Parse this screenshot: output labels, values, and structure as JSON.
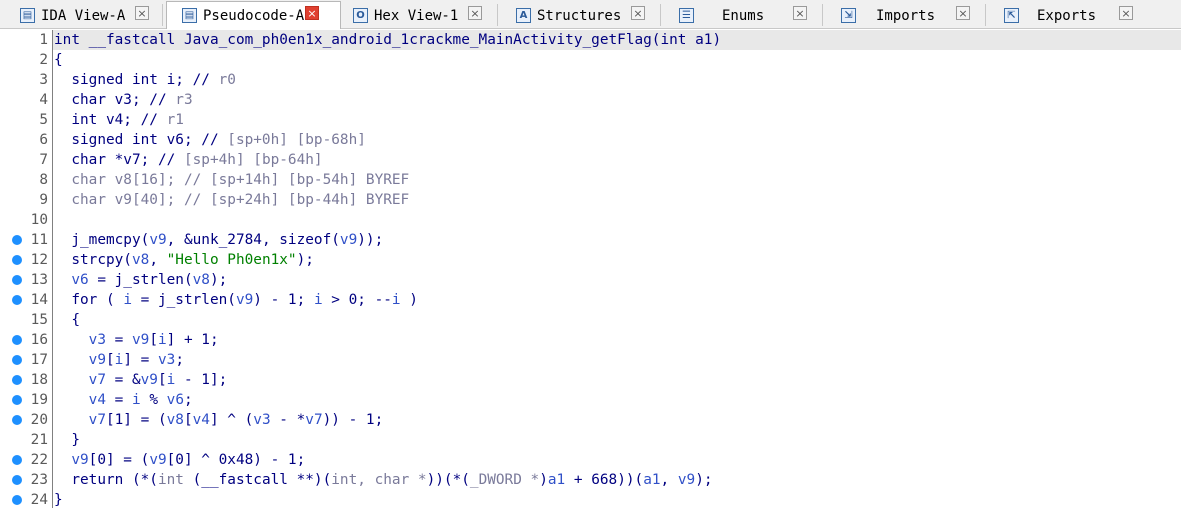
{
  "tabs": [
    {
      "label": "IDA View-A",
      "icon": "ida-view-icon",
      "glyph": "▤",
      "active": false
    },
    {
      "label": "Pseudocode-A",
      "icon": "pseudocode-icon",
      "glyph": "▤",
      "active": true
    },
    {
      "label": "Hex View-1",
      "icon": "hex-view-icon",
      "glyph": "O",
      "active": false
    },
    {
      "label": "Structures",
      "icon": "structures-icon",
      "glyph": "A",
      "active": false
    },
    {
      "label": "Enums",
      "icon": "enums-icon",
      "glyph": "☰",
      "active": false
    },
    {
      "label": "Imports",
      "icon": "imports-icon",
      "glyph": "⇲",
      "active": false
    },
    {
      "label": "Exports",
      "icon": "exports-icon",
      "glyph": "⇱",
      "active": false
    }
  ],
  "close_glyph": "×",
  "code": [
    {
      "n": "1",
      "bp": false,
      "parts": [
        [
          "k",
          "int __fastcall Java_com_ph0en1x_android_1crackme_MainActivity_getFlag(int a1)"
        ]
      ]
    },
    {
      "n": "2",
      "bp": false,
      "parts": [
        [
          "k",
          "{"
        ]
      ]
    },
    {
      "n": "3",
      "bp": false,
      "parts": [
        [
          "k",
          "  signed int i; // "
        ],
        [
          "g",
          "r0"
        ]
      ]
    },
    {
      "n": "4",
      "bp": false,
      "parts": [
        [
          "k",
          "  char v3; // "
        ],
        [
          "g",
          "r3"
        ]
      ]
    },
    {
      "n": "5",
      "bp": false,
      "parts": [
        [
          "k",
          "  int v4; // "
        ],
        [
          "g",
          "r1"
        ]
      ]
    },
    {
      "n": "6",
      "bp": false,
      "parts": [
        [
          "k",
          "  signed int v6; // "
        ],
        [
          "g",
          "[sp+0h] [bp-68h]"
        ]
      ]
    },
    {
      "n": "7",
      "bp": false,
      "parts": [
        [
          "k",
          "  char *v7; // "
        ],
        [
          "g",
          "[sp+4h] [bp-64h]"
        ]
      ]
    },
    {
      "n": "8",
      "bp": false,
      "parts": [
        [
          "g",
          "  char v8[16]; // [sp+14h] [bp-54h] BYREF"
        ]
      ]
    },
    {
      "n": "9",
      "bp": false,
      "parts": [
        [
          "g",
          "  char v9[40]; // [sp+24h] [bp-44h] BYREF"
        ]
      ]
    },
    {
      "n": "10",
      "bp": false,
      "parts": [
        [
          "k",
          ""
        ]
      ]
    },
    {
      "n": "11",
      "bp": true,
      "parts": [
        [
          "k",
          "  j_memcpy("
        ],
        [
          "v",
          "v9"
        ],
        [
          "k",
          ", &unk_2784, sizeof("
        ],
        [
          "v",
          "v9"
        ],
        [
          "k",
          "));"
        ]
      ]
    },
    {
      "n": "12",
      "bp": true,
      "parts": [
        [
          "k",
          "  strcpy("
        ],
        [
          "v",
          "v8"
        ],
        [
          "k",
          ", "
        ],
        [
          "s",
          "\"Hello Ph0en1x\""
        ],
        [
          "k",
          ");"
        ]
      ]
    },
    {
      "n": "13",
      "bp": true,
      "parts": [
        [
          "v",
          "  v6"
        ],
        [
          "k",
          " = j_strlen("
        ],
        [
          "v",
          "v8"
        ],
        [
          "k",
          ");"
        ]
      ]
    },
    {
      "n": "14",
      "bp": true,
      "parts": [
        [
          "k",
          "  for ( "
        ],
        [
          "v",
          "i"
        ],
        [
          "k",
          " = j_strlen("
        ],
        [
          "v",
          "v9"
        ],
        [
          "k",
          ") - 1; "
        ],
        [
          "v",
          "i"
        ],
        [
          "k",
          " > 0; --"
        ],
        [
          "v",
          "i"
        ],
        [
          "k",
          " )"
        ]
      ]
    },
    {
      "n": "15",
      "bp": false,
      "parts": [
        [
          "k",
          "  {"
        ]
      ]
    },
    {
      "n": "16",
      "bp": true,
      "parts": [
        [
          "v",
          "    v3"
        ],
        [
          "k",
          " = "
        ],
        [
          "v",
          "v9"
        ],
        [
          "k",
          "["
        ],
        [
          "v",
          "i"
        ],
        [
          "k",
          "] + 1;"
        ]
      ]
    },
    {
      "n": "17",
      "bp": true,
      "parts": [
        [
          "v",
          "    v9"
        ],
        [
          "k",
          "["
        ],
        [
          "v",
          "i"
        ],
        [
          "k",
          "] = "
        ],
        [
          "v",
          "v3"
        ],
        [
          "k",
          ";"
        ]
      ]
    },
    {
      "n": "18",
      "bp": true,
      "parts": [
        [
          "v",
          "    v7"
        ],
        [
          "k",
          " = &"
        ],
        [
          "v",
          "v9"
        ],
        [
          "k",
          "["
        ],
        [
          "v",
          "i"
        ],
        [
          "k",
          " - 1];"
        ]
      ]
    },
    {
      "n": "19",
      "bp": true,
      "parts": [
        [
          "v",
          "    v4"
        ],
        [
          "k",
          " = "
        ],
        [
          "v",
          "i"
        ],
        [
          "k",
          " % "
        ],
        [
          "v",
          "v6"
        ],
        [
          "k",
          ";"
        ]
      ]
    },
    {
      "n": "20",
      "bp": true,
      "parts": [
        [
          "v",
          "    v7"
        ],
        [
          "k",
          "[1] = ("
        ],
        [
          "v",
          "v8"
        ],
        [
          "k",
          "["
        ],
        [
          "v",
          "v4"
        ],
        [
          "k",
          "] ^ ("
        ],
        [
          "v",
          "v3"
        ],
        [
          "k",
          " - *"
        ],
        [
          "v",
          "v7"
        ],
        [
          "k",
          ")) - 1;"
        ]
      ]
    },
    {
      "n": "21",
      "bp": false,
      "parts": [
        [
          "k",
          "  }"
        ]
      ]
    },
    {
      "n": "22",
      "bp": true,
      "parts": [
        [
          "v",
          "  v9"
        ],
        [
          "k",
          "[0] = ("
        ],
        [
          "v",
          "v9"
        ],
        [
          "k",
          "[0] ^ 0x48) - 1;"
        ]
      ]
    },
    {
      "n": "23",
      "bp": true,
      "parts": [
        [
          "k",
          "  return (*("
        ],
        [
          "g",
          "int"
        ],
        [
          "k",
          " (__fastcall **)("
        ],
        [
          "g",
          "int, char *"
        ],
        [
          "k",
          "))(*("
        ],
        [
          "g",
          "_DWORD *"
        ],
        [
          "k",
          ")"
        ],
        [
          "v",
          "a1"
        ],
        [
          "k",
          " + 668))("
        ],
        [
          "v",
          "a1"
        ],
        [
          "k",
          ", "
        ],
        [
          "v",
          "v9"
        ],
        [
          "k",
          ");"
        ]
      ]
    },
    {
      "n": "24",
      "bp": true,
      "parts": [
        [
          "k",
          "}"
        ]
      ]
    }
  ]
}
